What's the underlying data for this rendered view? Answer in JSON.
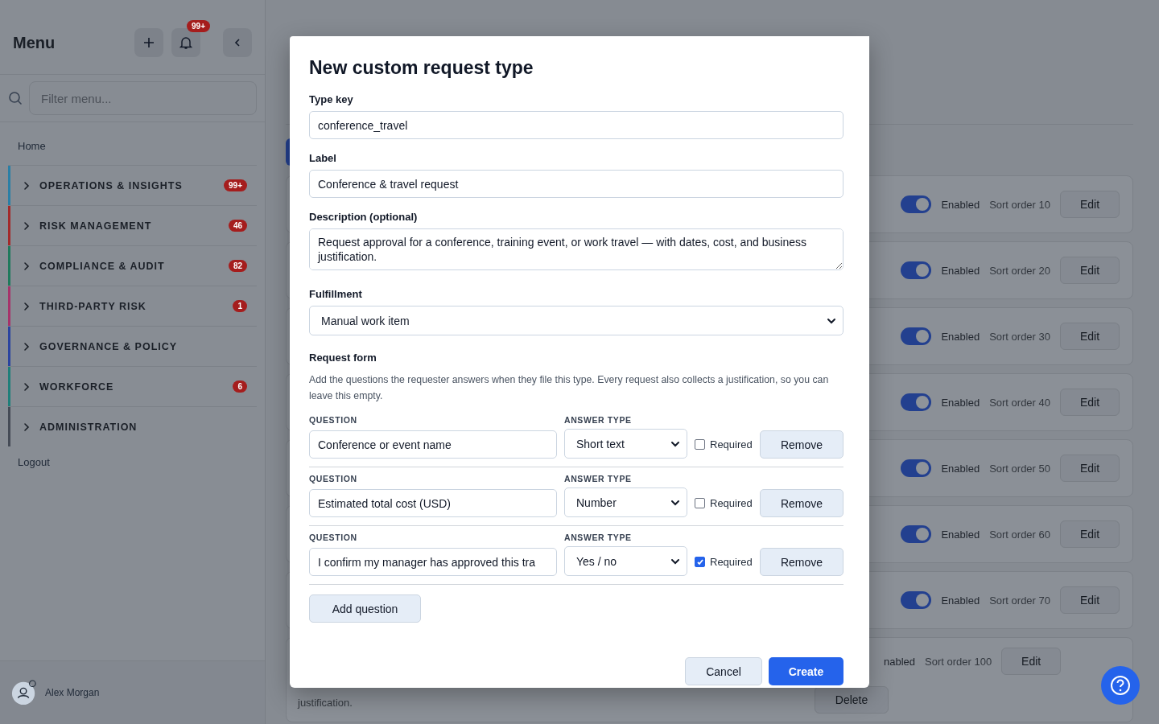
{
  "sidebar": {
    "title": "Menu",
    "notification_badge": "99+",
    "filter_placeholder": "Filter menu...",
    "home": "Home",
    "groups": [
      {
        "label": "OPERATIONS & INSIGHTS",
        "color": "#2a7fa6",
        "badge": "99+"
      },
      {
        "label": "RISK MANAGEMENT",
        "color": "#a32a2a",
        "badge": "46"
      },
      {
        "label": "COMPLIANCE & AUDIT",
        "color": "#1f7a5c",
        "badge": "82"
      },
      {
        "label": "THIRD-PARTY RISK",
        "color": "#a6336a",
        "badge": "1"
      },
      {
        "label": "GOVERNANCE & POLICY",
        "color": "#2a44a0"
      },
      {
        "label": "WORKFORCE",
        "color": "#1f7f7a",
        "badge": "6"
      },
      {
        "label": "ADMINISTRATION",
        "color": "#454b56"
      }
    ],
    "logout": "Logout",
    "user": "Alex Morgan"
  },
  "page": {
    "types": [
      {
        "on": true,
        "status": "Enabled",
        "sort_order": "Sort order 10",
        "edit": "Edit"
      },
      {
        "on": true,
        "status": "Enabled",
        "sort_order": "Sort order 20",
        "edit": "Edit"
      },
      {
        "on": true,
        "status": "Enabled",
        "sort_order": "Sort order 30",
        "edit": "Edit"
      },
      {
        "on": true,
        "status": "Enabled",
        "sort_order": "Sort order 40",
        "edit": "Edit"
      },
      {
        "on": true,
        "status": "Enabled",
        "sort_order": "Sort order 50",
        "edit": "Edit"
      },
      {
        "on": true,
        "status": "Enabled",
        "sort_order": "Sort order 60",
        "edit": "Edit"
      },
      {
        "on": true,
        "status": "Enabled",
        "sort_order": "Sort order 70",
        "edit": "Edit"
      }
    ],
    "last_type": {
      "status": "nabled",
      "sort_order": "Sort order 100",
      "edit": "Edit",
      "description": "justification.",
      "delete": "Delete"
    }
  },
  "dialog": {
    "title": "New custom request type",
    "fields": [
      {
        "kind": "input",
        "label": "Type key",
        "value": "conference_travel"
      },
      {
        "kind": "input",
        "label": "Label",
        "value": "Conference & travel request"
      },
      {
        "kind": "textarea",
        "label": "Description (optional)",
        "value": "Request approval for a conference, training event, or work travel — with dates, cost, and business justification."
      },
      {
        "kind": "select",
        "label": "Fulfillment",
        "value": "Manual work item"
      }
    ],
    "form_heading": "Request form",
    "form_help": "Add the questions the requester answers when they file this type. Every request also collects a justification, so you can leave this empty.",
    "questions": [
      {
        "question_label": "QUESTION",
        "question": "Conference or event name",
        "answer_label": "ANSWER TYPE",
        "answer_type": "Short text",
        "required": false,
        "required_label": "Required",
        "remove": "Remove"
      },
      {
        "question_label": "QUESTION",
        "question": "Estimated total cost (USD)",
        "answer_label": "ANSWER TYPE",
        "answer_type": "Number",
        "required": false,
        "required_label": "Required",
        "remove": "Remove"
      },
      {
        "question_label": "QUESTION",
        "question": "I confirm my manager has approved this tra",
        "answer_label": "ANSWER TYPE",
        "answer_type": "Yes / no",
        "required": true,
        "required_label": "Required",
        "remove": "Remove"
      }
    ],
    "add_question": "Add question",
    "cancel": "Cancel",
    "create": "Create"
  }
}
